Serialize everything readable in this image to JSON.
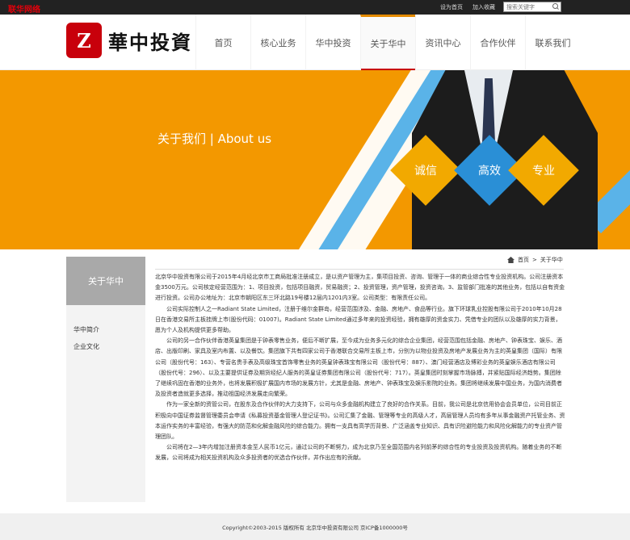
{
  "corner_text": "联华网络",
  "top_links": [
    {
      "label": "设为首页"
    },
    {
      "label": "加入收藏"
    }
  ],
  "search": {
    "placeholder": "搜索关键字"
  },
  "logo": {
    "mark": "Z",
    "name": "華中投資"
  },
  "nav": [
    {
      "label": "首页"
    },
    {
      "label": "核心业务"
    },
    {
      "label": "华中投资"
    },
    {
      "label": "关于华中"
    },
    {
      "label": "资讯中心"
    },
    {
      "label": "合作伙伴"
    },
    {
      "label": "联系我们"
    }
  ],
  "banner": {
    "title": "关于我们 | About us",
    "diamonds": [
      "诚信",
      "高效",
      "专业"
    ]
  },
  "sidebar": {
    "title": "关于华中",
    "links": [
      {
        "label": "华中简介"
      },
      {
        "label": "企业文化"
      }
    ]
  },
  "breadcrumb": {
    "home": "首页",
    "sep": ">",
    "current": "关于华中"
  },
  "content": {
    "p1": "北京华中投资有限公司于2015年4月经北京市工商局批准注册成立，是以资产管理为主，集项目投资、咨询、管理于一体的商业综合性专业投资机构。公司注册资本金3500万元。公司核定经营范围为：1、项目投资，包括项目融资，贸易融资；2、投资管理，资产管理，投资咨询。3、监管部门批准的其他业务，包括以自有资金进行投资。公司办公地址为：北京市朝阳区东三环北路19号楼12层内1201内3室。公司类型：有限责任公司。",
    "p2": "公司实际控制人之一Radiant State Limited，注册于维尔金群岛，经营范围涉及、金融、房地产、食品等行业。旗下环球乳业控股有限公司于2010年10月28日在香港交易所主板挂牌上市(股份代码：01007)。Radiant State Limited通过多年来的投资经验，拥有雄厚的资金实力、凭借专业的团队以及雄厚的实力背景，愿为个人及机构提供更多帮助。",
    "p3": "公司的另一合作伙伴香港英皇集团是于钟表零售业务，便后不断扩展，至今成为业务多元化的综合企业集团，经营范围包括金融、房地产、钟表珠宝、娱乐、酒店、出版印刷、家具及室内布置、以及餐饮。集团旗下共有四家公司于香港联合交易所主板上市，分别为以物业投资及房地产发展业务为主的英皇集团（国际）有限公司（股份代号：163）、专营名贵手表及高级珠宝首饰零售业务的英皇钟表珠宝有限公司（股份代号：887）、澳门经营酒店及博彩业务的英皇娱乐酒店有限公司（股份代号：296）、以及主要提供证券及期货经纪人服务的英皇证券集团有限公司（股份代号：717）。英皇集团时刻掌握市场脉搏，并紧贴国际经济趋势。集团除了继续巩固在香港的业务外，也将发展积极扩展国内市场的发展方针，尤其是金融、房地产、钟表珠宝及娱乐影院的业务。集团将继续发展中国业务，为国内消费者及投资者造就更多选择，推动祖国经济发展走向繁荣。",
    "p4": "作为一家全新的资管公司，在股东及合作伙伴的大力支持下，公司与众多金融机构建立了良好的合作关系。目前，我公司是北京信用协会会员单位，公司目前正积极向中国证券监督管理委员会申请《私募投资基金管理人登记证书》。公司汇集了金融、管理等专业的高级人才，高层管理人员均有多年从事金融资产托管业务、资本运作实务的丰富经验，有强大的防范和化解金融风险的综合能力。拥有一支具有高学历背景、广泛涵盖专业知识、具有识险避险能力和风险化解能力的专业资产管理团队。",
    "p5": "公司将在2—3年内增加注册资本金至人民币1亿元，通过公司的不断努力，成为北京乃至全国范围内名列前茅的综合性的专业投资及投资机构。随着业务的不断发展，公司将成为相关投资机构及众多投资者的优选合作伙伴，并作出应有的贡献。"
  },
  "footer": "Copyright©2003-2015  版权所有  北京华中投资有限公司  京ICP备1000000号",
  "colors": {
    "accent": "#f39800",
    "brand": "#c8000b",
    "blue": "#2a8fd6"
  }
}
